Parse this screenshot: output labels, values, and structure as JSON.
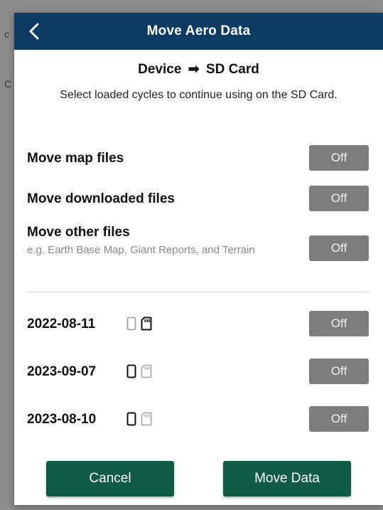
{
  "header": {
    "title": "Move Aero Data"
  },
  "direction": {
    "from": "Device",
    "arrow": "➡",
    "to": "SD Card"
  },
  "description": "Select loaded cycles to continue using on the SD Card.",
  "options": [
    {
      "label": "Move map files",
      "toggle": "Off"
    },
    {
      "label": "Move downloaded files",
      "toggle": "Off"
    },
    {
      "label": "Move other files",
      "sublabel": "e.g. Earth Base Map, Giant Reports, and Terrain",
      "toggle": "Off"
    }
  ],
  "cycles": [
    {
      "date": "2022-08-11",
      "toggle": "Off",
      "device_icon": "device-outline-icon",
      "sd_icon": "sd-card-icon",
      "active": "sd"
    },
    {
      "date": "2023-09-07",
      "toggle": "Off",
      "device_icon": "device-icon",
      "sd_icon": "sd-card-outline-icon",
      "active": "device"
    },
    {
      "date": "2023-08-10",
      "toggle": "Off",
      "device_icon": "device-icon",
      "sd_icon": "sd-card-outline-icon",
      "active": "device"
    }
  ],
  "buttons": {
    "cancel": "Cancel",
    "move": "Move Data"
  },
  "colors": {
    "titlebar": "#0d3b63",
    "toggle_off": "#7d7d7d",
    "button": "#0f5b45"
  }
}
